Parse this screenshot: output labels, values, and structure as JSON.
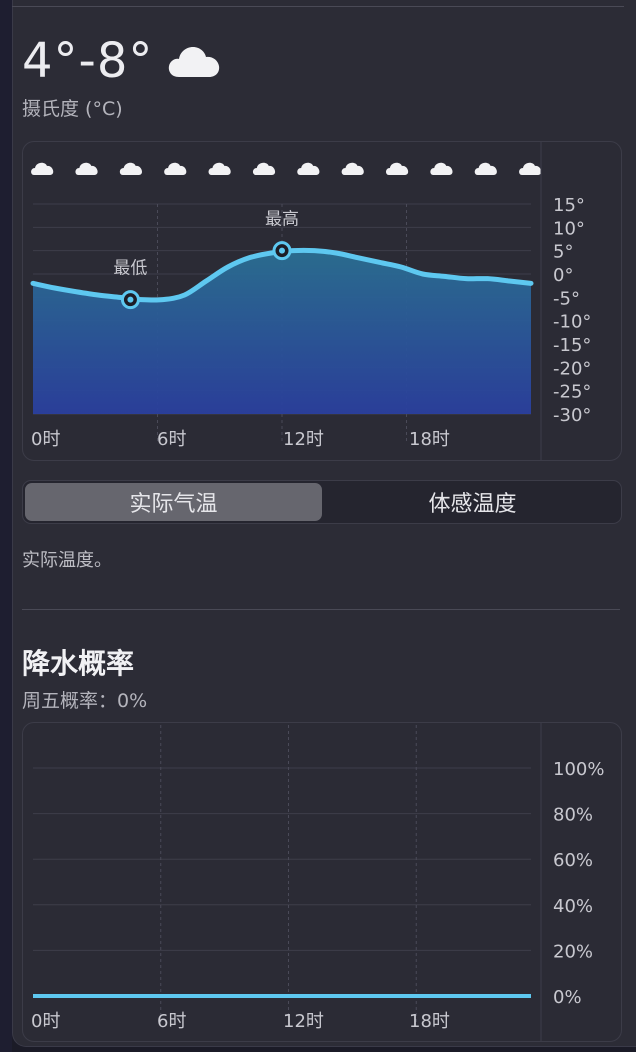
{
  "header": {
    "temp_range": "4°-8°",
    "weather_icon": "cloud-icon",
    "unit_label": "摄氏度 (°C)"
  },
  "temperature_chart": {
    "hourly_icons": [
      "cloud-icon",
      "cloud-icon",
      "cloud-icon",
      "cloud-icon",
      "cloud-icon",
      "cloud-icon",
      "cloud-icon",
      "cloud-icon",
      "cloud-icon",
      "cloud-icon",
      "cloud-icon",
      "cloud-icon"
    ],
    "min_label": "最低",
    "max_label": "最高",
    "x_ticks": [
      "0时",
      "6时",
      "12时",
      "18时"
    ],
    "y_ticks": [
      "15°",
      "10°",
      "5°",
      "0°",
      "-5°",
      "-10°",
      "-15°",
      "-20°",
      "-25°",
      "-30°"
    ]
  },
  "tabs": {
    "actual": "实际气温",
    "feels_like": "体感温度"
  },
  "description": "实际温度。",
  "precipitation": {
    "title": "降水概率",
    "subtitle": "周五概率：0%",
    "x_ticks": [
      "0时",
      "6时",
      "12时",
      "18时"
    ],
    "y_ticks": [
      "100%",
      "80%",
      "60%",
      "40%",
      "20%",
      "0%"
    ]
  },
  "colors": {
    "line": "#5ec8f0",
    "fill_top": "#2a6f92",
    "fill_bottom": "#2a3f9e",
    "precip_line": "#5ec8f0"
  },
  "chart_data": [
    {
      "type": "area",
      "x": [
        0,
        1,
        2,
        3,
        4,
        5,
        6,
        7,
        8,
        9,
        10,
        11,
        12,
        13,
        14,
        15,
        16,
        17,
        18,
        19,
        20,
        21,
        22,
        23
      ],
      "series": [
        {
          "values": [
            -2,
            -3,
            -3.8,
            -4.5,
            -5,
            -5.5,
            -5.5,
            -4.5,
            -1.5,
            1.5,
            3.5,
            4.5,
            5,
            5,
            4.5,
            3.5,
            2.5,
            1.5,
            0,
            -0.5,
            -1,
            -1,
            -1.5,
            -2
          ]
        }
      ],
      "xticks": [
        "0时",
        "6时",
        "12时",
        "18时"
      ],
      "ylim": [
        -30,
        15
      ],
      "yticks": [
        "15°",
        "10°",
        "5°",
        "0°",
        "-5°",
        "-10°",
        "-15°",
        "-20°",
        "-25°",
        "-30°"
      ],
      "annotations": [
        {
          "label": "最低",
          "x": 4.5,
          "y": -5.5
        },
        {
          "label": "最高",
          "x": 11.5,
          "y": 5
        }
      ]
    },
    {
      "type": "line",
      "x": [
        0,
        23
      ],
      "series": [
        {
          "values": [
            0,
            0
          ]
        }
      ],
      "xticks": [
        "0时",
        "6时",
        "12时",
        "18时"
      ],
      "ylim": [
        0,
        100
      ],
      "yticks": [
        "100%",
        "80%",
        "60%",
        "40%",
        "20%",
        "0%"
      ]
    }
  ]
}
